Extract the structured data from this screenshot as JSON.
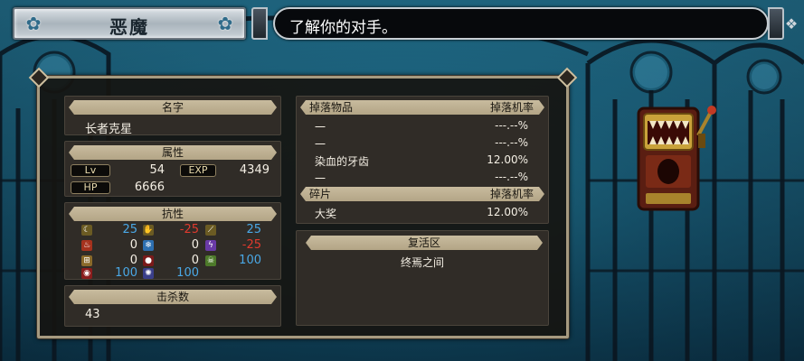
{
  "header": {
    "enemy_name": "恶魔",
    "message": "了解你的对手。"
  },
  "name_section": {
    "title": "名字",
    "value": "长者克星"
  },
  "attributes": {
    "title": "属性",
    "lv_label": "Lv",
    "lv_value": "54",
    "exp_label": "EXP",
    "exp_value": "4349",
    "hp_label": "HP",
    "hp_value": "6666"
  },
  "resistances": {
    "title": "抗性",
    "items": [
      {
        "icon": "crescent-icon",
        "value": "25",
        "color": "#4aa8e6"
      },
      {
        "icon": "slash-icon",
        "value": "-25",
        "color": "#e03a2e"
      },
      {
        "icon": "thrust-icon",
        "value": "25",
        "color": "#4aa8e6"
      },
      {
        "icon": "fire-icon",
        "value": "0",
        "color": "#f4efe4"
      },
      {
        "icon": "ice-icon",
        "value": "0",
        "color": "#f4efe4"
      },
      {
        "icon": "lightning-icon",
        "value": "-25",
        "color": "#e03a2e"
      },
      {
        "icon": "strike-icon",
        "value": "0",
        "color": "#f4efe4"
      },
      {
        "icon": "dark-icon",
        "value": "0",
        "color": "#f4efe4"
      },
      {
        "icon": "poison-icon",
        "value": "100",
        "color": "#4aa8e6"
      },
      {
        "icon": "curse-icon",
        "value": "100",
        "color": "#4aa8e6"
      },
      {
        "icon": "petrify-icon",
        "value": "100",
        "color": "#4aa8e6"
      }
    ]
  },
  "kills": {
    "title": "击杀数",
    "value": "43"
  },
  "drops": {
    "header_name": "掉落物品",
    "header_rate": "掉落机率",
    "items": [
      {
        "name": "一",
        "rate": "---.--%"
      },
      {
        "name": "一",
        "rate": "---.--%"
      },
      {
        "name": "染血的牙齿",
        "rate": "12.00%"
      },
      {
        "name": "一",
        "rate": "---.--%"
      }
    ]
  },
  "shards": {
    "header_name": "碎片",
    "header_rate": "掉落机率",
    "items": [
      {
        "name": "大奖",
        "rate": "12.00%"
      }
    ]
  },
  "revival": {
    "title": "复活区",
    "value": "终焉之间"
  }
}
